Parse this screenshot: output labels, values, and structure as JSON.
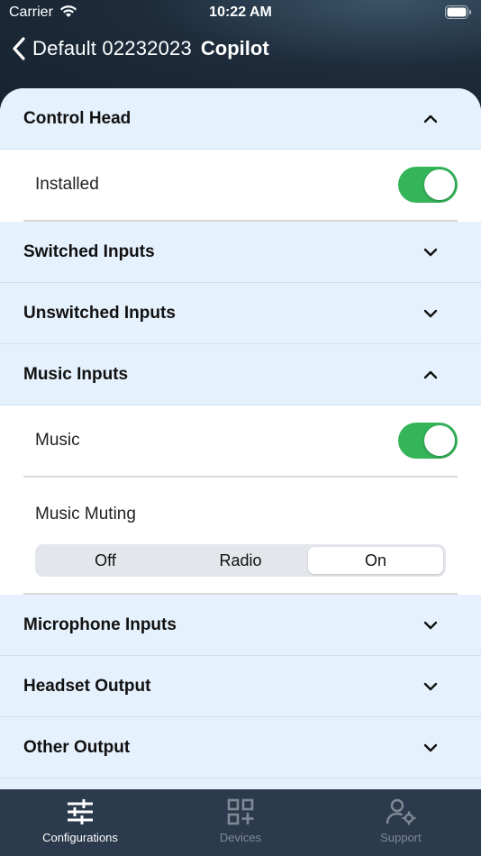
{
  "status_bar": {
    "carrier": "Carrier",
    "time": "10:22 AM"
  },
  "navbar": {
    "title": "Default 02232023",
    "subtitle": "Copilot"
  },
  "sections": {
    "control_head": {
      "title": "Control Head",
      "expanded": true
    },
    "installed": {
      "label": "Installed",
      "on": true
    },
    "switched_inputs": {
      "title": "Switched Inputs",
      "expanded": false
    },
    "unswitched_inputs": {
      "title": "Unswitched Inputs",
      "expanded": false
    },
    "music_inputs": {
      "title": "Music Inputs",
      "expanded": true
    },
    "music": {
      "label": "Music",
      "on": true
    },
    "music_muting": {
      "label": "Music Muting",
      "options": [
        "Off",
        "Radio",
        "On"
      ],
      "selected": "On"
    },
    "microphone_inputs": {
      "title": "Microphone Inputs",
      "expanded": false
    },
    "headset_output": {
      "title": "Headset Output",
      "expanded": false
    },
    "other_output": {
      "title": "Other Output",
      "expanded": false
    }
  },
  "tabbar": {
    "items": [
      {
        "label": "Configurations",
        "icon": "sliders-icon",
        "active": true
      },
      {
        "label": "Devices",
        "icon": "qr-grid-icon",
        "active": false
      },
      {
        "label": "Support",
        "icon": "user-gear-icon",
        "active": false
      }
    ]
  },
  "colors": {
    "accent_green": "#35b55a",
    "section_bg": "#e5f1fc",
    "tabbar_bg": "#2b3a4c"
  }
}
